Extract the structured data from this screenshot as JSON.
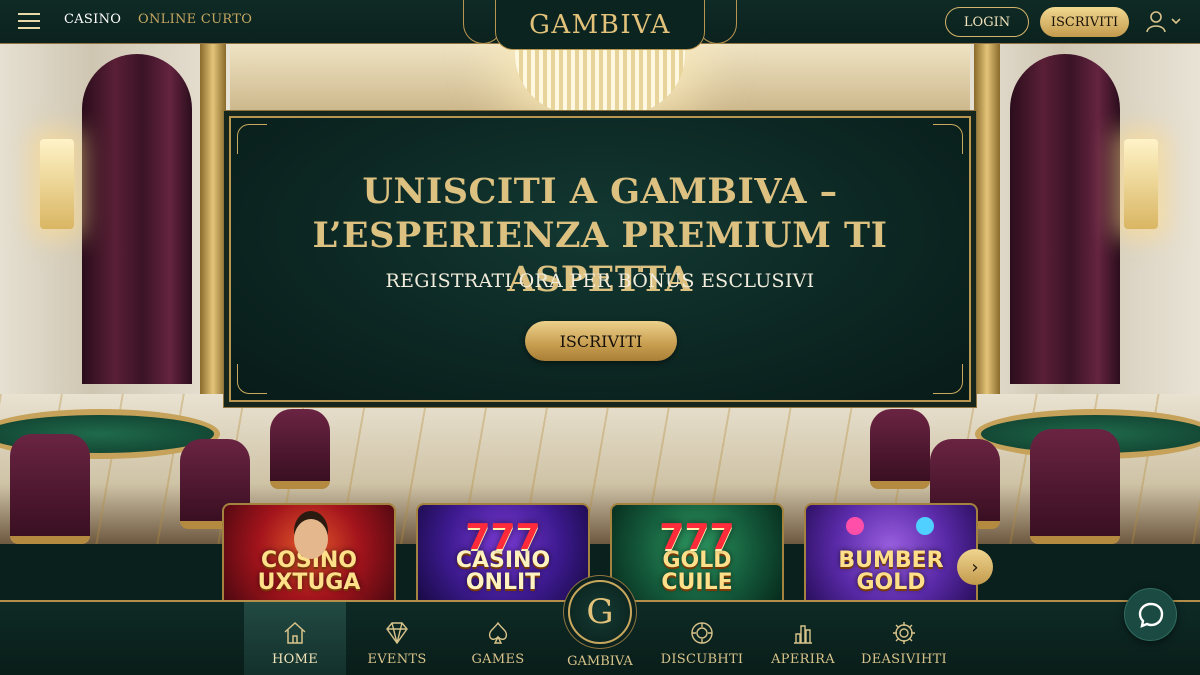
{
  "topbar": {
    "nav": [
      "CASINO",
      "ONLINE CURTO"
    ],
    "logo": "GAMBIVA",
    "login_label": "LOGIN",
    "signup_label": "ISCRIVITI"
  },
  "hero": {
    "title": "UNISCITI A GAMBIVA – L’ESPERIENZA PREMIUM TI ASPETTA",
    "subtitle": "REGISTRATI ORA PER BONUS ESCLUSIVI",
    "cta_label": "ISCRIVITI"
  },
  "games": [
    {
      "name": "COSINO\nUXTUGA"
    },
    {
      "name": "CASINO\nONLIT"
    },
    {
      "name": "GOLD\nCUILE"
    },
    {
      "name": "BUMBER\nGOLD"
    }
  ],
  "bottom_nav": {
    "items": [
      {
        "label": "HOME",
        "icon": "home-icon",
        "active": true
      },
      {
        "label": "EVENTS",
        "icon": "diamond-icon"
      },
      {
        "label": "GAMES",
        "icon": "spade-icon"
      },
      {
        "label": "DISCUBHTI",
        "icon": "chip-icon"
      },
      {
        "label": "APERIRA",
        "icon": "chart-bars-icon"
      },
      {
        "label": "DEASIVIHTI",
        "icon": "gear-icon"
      }
    ],
    "center": {
      "label": "GAMBIVA",
      "glyph": "G"
    }
  },
  "colors": {
    "gold": "#d4b46b",
    "dark_green": "#0b221e",
    "accent_button": "#c79d4f"
  }
}
